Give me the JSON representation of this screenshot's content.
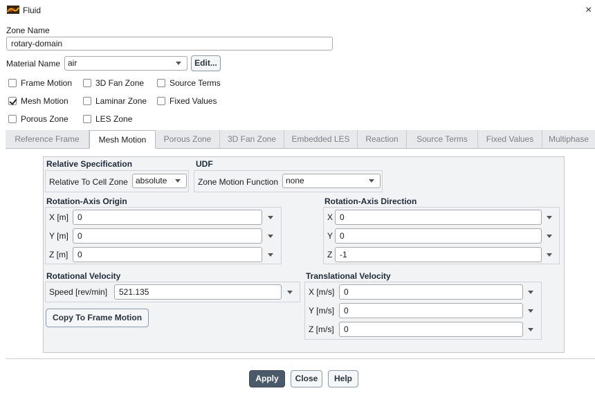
{
  "window": {
    "title": "Fluid",
    "close_glyph": "×",
    "icon": "fluent-app-icon"
  },
  "zone": {
    "label": "Zone Name",
    "value": "rotary-domain"
  },
  "material": {
    "label": "Material Name",
    "value": "air",
    "edit_button": "Edit..."
  },
  "checkboxes": {
    "frame_motion": {
      "label": "Frame Motion",
      "checked": false
    },
    "fan_zone": {
      "label": "3D Fan Zone",
      "checked": false
    },
    "source_terms": {
      "label": "Source Terms",
      "checked": false
    },
    "mesh_motion": {
      "label": "Mesh Motion",
      "checked": true
    },
    "laminar_zone": {
      "label": "Laminar Zone",
      "checked": false
    },
    "fixed_values": {
      "label": "Fixed Values",
      "checked": false
    },
    "porous_zone": {
      "label": "Porous Zone",
      "checked": false
    },
    "les_zone": {
      "label": "LES Zone",
      "checked": false
    }
  },
  "tabs": [
    {
      "label": "Reference Frame",
      "active": false
    },
    {
      "label": "Mesh Motion",
      "active": true
    },
    {
      "label": "Porous Zone",
      "active": false
    },
    {
      "label": "3D Fan Zone",
      "active": false
    },
    {
      "label": "Embedded LES",
      "active": false
    },
    {
      "label": "Reaction",
      "active": false
    },
    {
      "label": "Source Terms",
      "active": false
    },
    {
      "label": "Fixed Values",
      "active": false
    },
    {
      "label": "Multiphase",
      "active": false
    }
  ],
  "mesh_motion": {
    "relative_spec": {
      "heading": "Relative Specification",
      "label": "Relative To Cell Zone",
      "value": "absolute"
    },
    "udf": {
      "heading": "UDF",
      "label": "Zone Motion Function",
      "value": "none"
    },
    "axis_origin": {
      "heading": "Rotation-Axis Origin",
      "x": {
        "label": "X [m]",
        "value": "0"
      },
      "y": {
        "label": "Y [m]",
        "value": "0"
      },
      "z": {
        "label": "Z [m]",
        "value": "0"
      }
    },
    "axis_direction": {
      "heading": "Rotation-Axis Direction",
      "x": {
        "label": "X",
        "value": "0"
      },
      "y": {
        "label": "Y",
        "value": "0"
      },
      "z": {
        "label": "Z",
        "value": "-1"
      }
    },
    "rotational_velocity": {
      "heading": "Rotational Velocity",
      "label": "Speed [rev/min]",
      "value": "521.135"
    },
    "copy_button": "Copy To Frame Motion",
    "translational_velocity": {
      "heading": "Translational Velocity",
      "x": {
        "label": "X [m/s]",
        "value": "0"
      },
      "y": {
        "label": "Y [m/s]",
        "value": "0"
      },
      "z": {
        "label": "Z [m/s]",
        "value": "0"
      }
    }
  },
  "buttons": {
    "apply": "Apply",
    "close": "Close",
    "help": "Help"
  },
  "colors": {
    "apply_bg": "#4b5a6b",
    "panel_bg": "#f2f3f5",
    "tabbar_bg": "#e8e9eb"
  }
}
